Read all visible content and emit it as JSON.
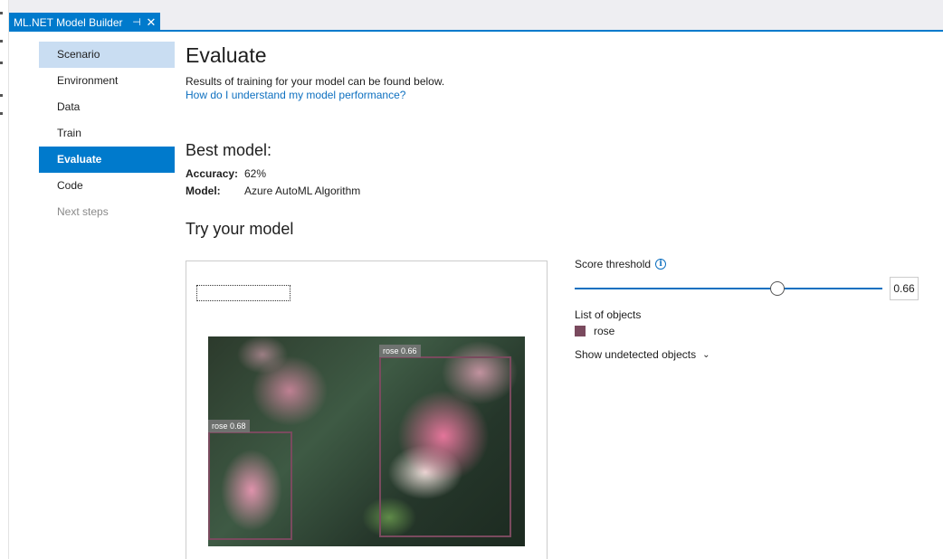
{
  "tab": {
    "title": "ML.NET Model Builder",
    "pin_glyph": "⊣",
    "close_glyph": "✕"
  },
  "sidebar": {
    "items": [
      {
        "label": "Scenario",
        "state": "visited"
      },
      {
        "label": "Environment",
        "state": "normal"
      },
      {
        "label": "Data",
        "state": "normal"
      },
      {
        "label": "Train",
        "state": "normal"
      },
      {
        "label": "Evaluate",
        "state": "active"
      },
      {
        "label": "Code",
        "state": "normal"
      },
      {
        "label": "Next steps",
        "state": "disabled"
      }
    ]
  },
  "main": {
    "title": "Evaluate",
    "subtitle": "Results of training for your model can be found below.",
    "help_link": "How do I understand my model performance?"
  },
  "best_model": {
    "title": "Best model:",
    "accuracy_label": "Accuracy:",
    "accuracy_value": "62%",
    "model_label": "Model:",
    "model_value": "Azure AutoML Algorithm"
  },
  "try_model": {
    "title": "Try your model",
    "detections": [
      {
        "label": "rose 0.66"
      },
      {
        "label": "rose 0.68"
      }
    ]
  },
  "threshold": {
    "label": "Score threshold",
    "value": "0.66",
    "slider_fraction": 0.66,
    "info_glyph": "i"
  },
  "objects": {
    "label": "List of objects",
    "items": [
      {
        "name": "rose",
        "color": "#7a4a5e"
      }
    ],
    "show_undetected": "Show undetected objects",
    "chevron_glyph": "⌄"
  },
  "colors": {
    "accent": "#007acc",
    "link": "#0e70c0",
    "visited_nav": "#c9ddf2"
  }
}
